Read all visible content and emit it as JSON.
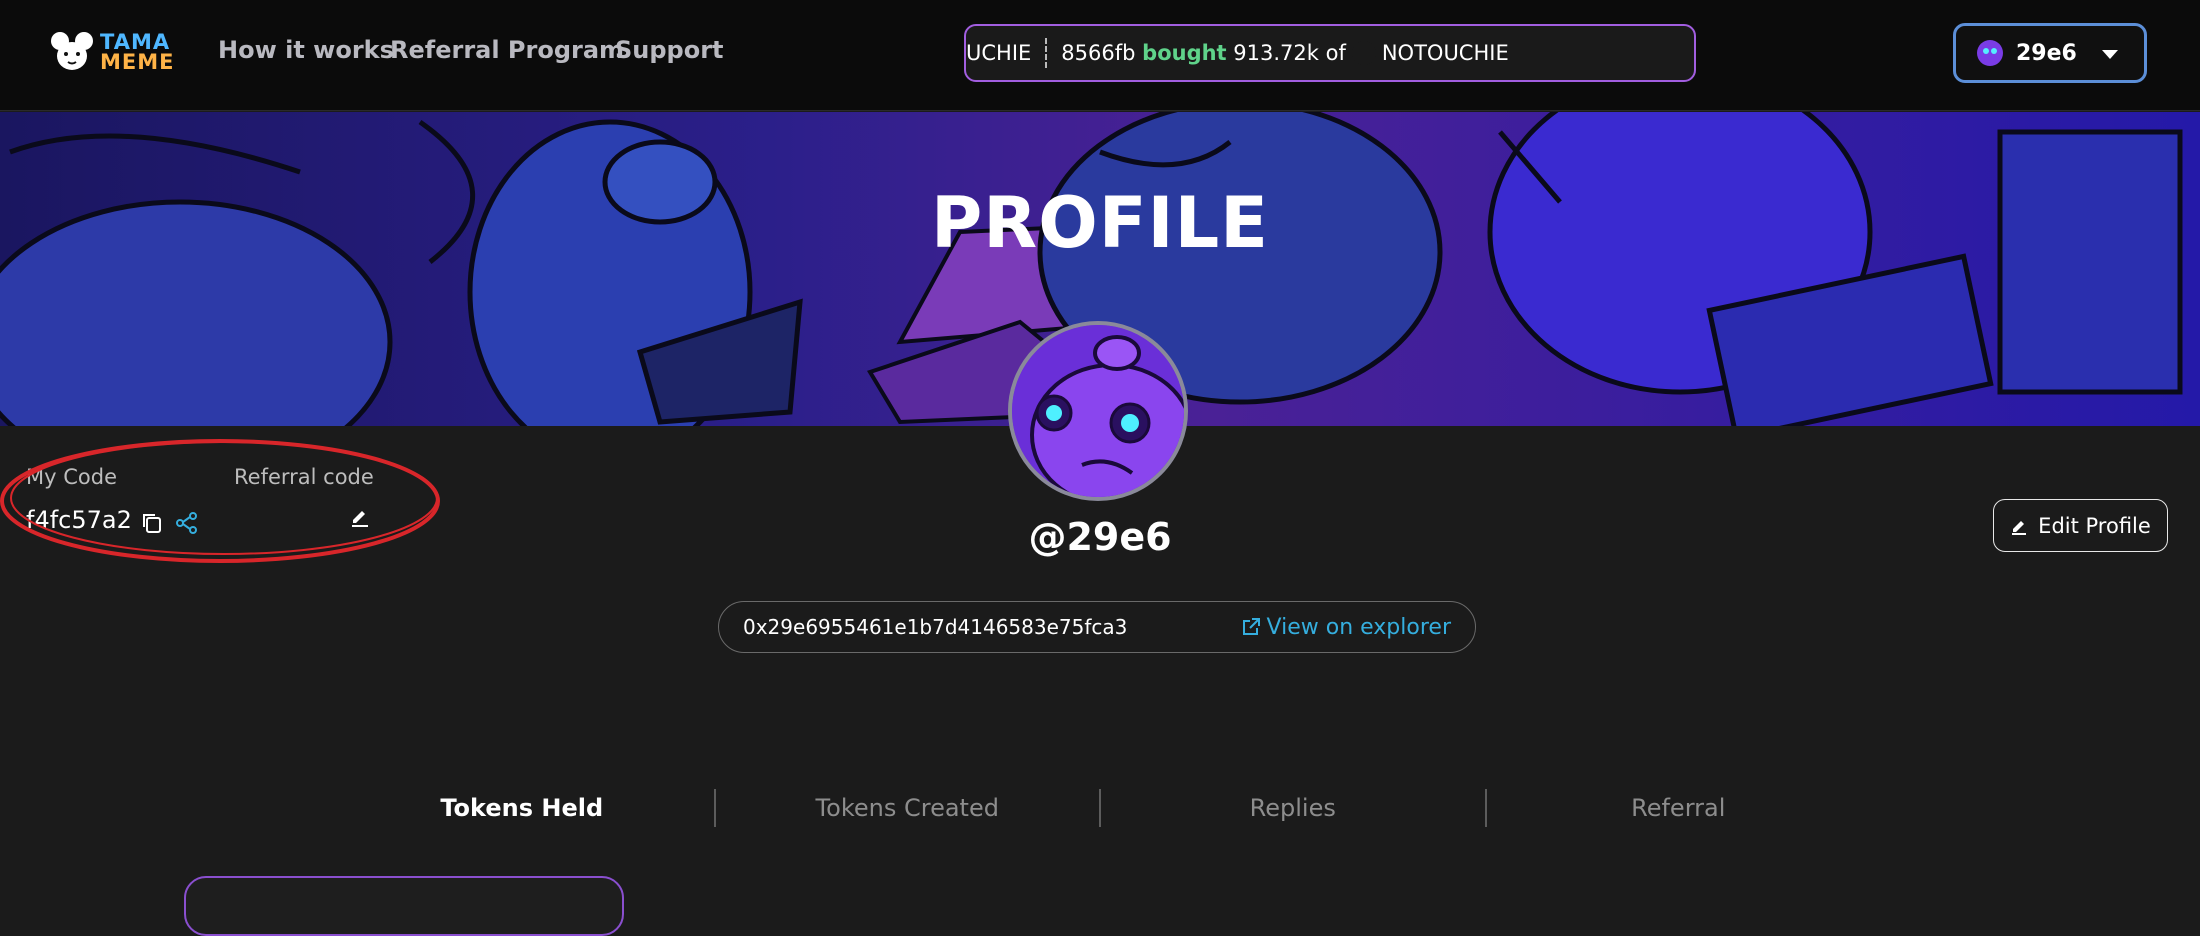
{
  "header": {
    "logo_line1": "TAMA",
    "logo_line2": "MEME",
    "nav": [
      "How it works",
      "Referral Program",
      "Support"
    ],
    "ticker": {
      "prefix": "UCHIE",
      "address": "8566fb",
      "action": "bought",
      "amount": "913.72k of",
      "token": "NOTOUCHIE"
    },
    "wallet_label": "29e6"
  },
  "banner": {
    "title": "PROFILE"
  },
  "codes": {
    "my_code_label": "My Code",
    "my_code_value": "f4fc57a2",
    "referral_label": "Referral code"
  },
  "profile": {
    "username": "@29e6",
    "edit_label": "Edit Profile",
    "address": "0x29e6955461e1b7d4146583e75fca3",
    "explorer_label": "View on explorer"
  },
  "tabs": [
    "Tokens Held",
    "Tokens Created",
    "Replies",
    "Referral"
  ],
  "colors": {
    "accent_purple": "#a25ee0",
    "green": "#5fd38a",
    "link_blue": "#35aede",
    "annotation_red": "#d8262a"
  }
}
